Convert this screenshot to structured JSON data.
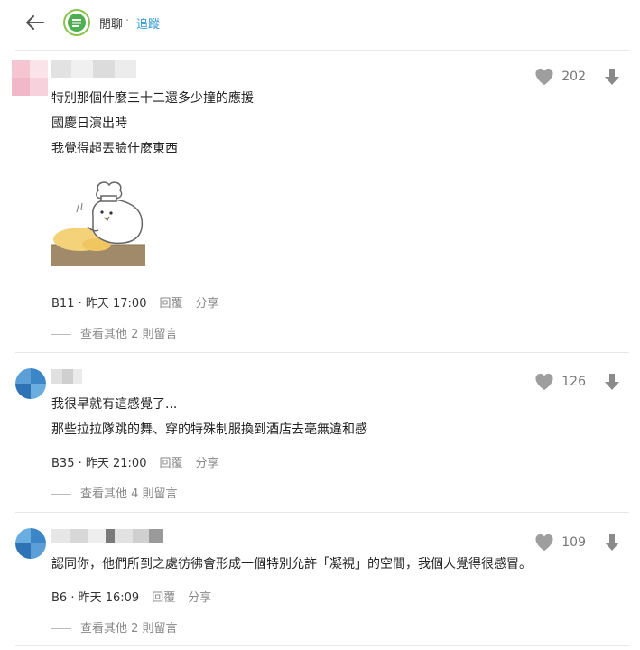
{
  "header": {
    "board_name": "閒聊",
    "separator": "·",
    "follow_label": "追蹤",
    "logo_color": "#8bc34a",
    "accent_color": "#3397cf"
  },
  "comments": [
    {
      "lines": [
        "特別那個什麼三十二還多少撞的應援",
        "國慶日演出時",
        "我覺得超丟臉什麼東西"
      ],
      "has_sticker": true,
      "floor": "B11",
      "time": "昨天 17:00",
      "reply_label": "回覆",
      "share_label": "分享",
      "view_more": "查看其他 2 則留言",
      "likes": "202"
    },
    {
      "lines": [
        "我很早就有這感覺了...",
        "那些拉拉隊跳的舞、穿的特殊制服換到酒店去毫無違和感"
      ],
      "has_sticker": false,
      "floor": "B35",
      "time": "昨天 21:00",
      "reply_label": "回覆",
      "share_label": "分享",
      "view_more": "查看其他 4 則留言",
      "likes": "126"
    },
    {
      "lines": [
        "認同你，他們所到之處彷彿會形成一個特別允許「凝視」的空間，我個人覺得很感冒。"
      ],
      "has_sticker": false,
      "floor": "B6",
      "time": "昨天 16:09",
      "reply_label": "回覆",
      "share_label": "分享",
      "view_more": "查看其他 2 則留言",
      "likes": "109"
    }
  ],
  "icons": {
    "back": "arrow-left-icon",
    "heart": "heart-icon",
    "dislike": "arrow-down-icon"
  }
}
